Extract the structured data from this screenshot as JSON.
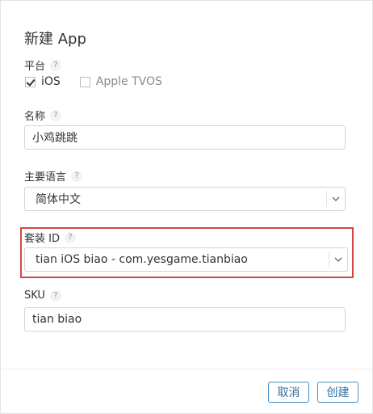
{
  "dialog": {
    "title": "新建 App"
  },
  "platform": {
    "label": "平台",
    "help": "?",
    "options": [
      {
        "label": "iOS",
        "checked": true
      },
      {
        "label": "Apple TVOS",
        "checked": false
      }
    ]
  },
  "name": {
    "label": "名称",
    "help": "?",
    "value": "小鸡跳跳"
  },
  "language": {
    "label": "主要语言",
    "help": "?",
    "selected": "简体中文"
  },
  "bundle": {
    "label": "套装 ID",
    "help": "?",
    "selected": "tian iOS biao - com.yesgame.tianbiao",
    "highlight_color": "#d64545"
  },
  "sku": {
    "label": "SKU",
    "help": "?",
    "value": "tian biao"
  },
  "buttons": {
    "cancel": "取消",
    "create": "创建"
  },
  "colors": {
    "button_border": "#4a8fc2",
    "button_text": "#2f6e9e"
  }
}
